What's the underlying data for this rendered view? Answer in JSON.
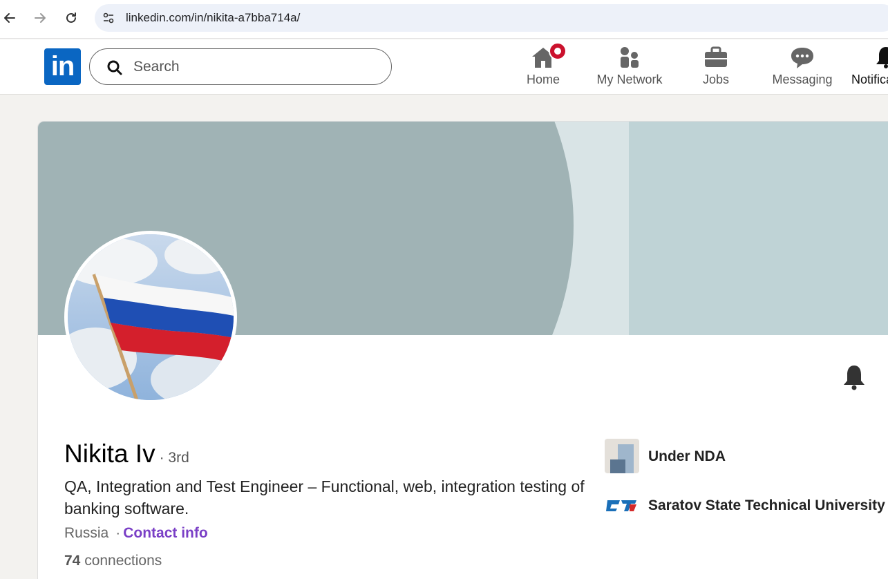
{
  "browser": {
    "url": "linkedin.com/in/nikita-a7bba714a/"
  },
  "linkedin_nav": {
    "logo_text": "in",
    "search_placeholder": "Search",
    "items": [
      {
        "label": "Home",
        "icon": "home-icon",
        "has_badge": true
      },
      {
        "label": "My Network",
        "icon": "people-icon"
      },
      {
        "label": "Jobs",
        "icon": "briefcase-icon"
      },
      {
        "label": "Messaging",
        "icon": "chat-icon"
      },
      {
        "label": "Notifications",
        "icon": "bell-icon"
      }
    ]
  },
  "profile": {
    "name": "Nikita Iv",
    "degree": "· 3rd",
    "headline": "QA, Integration and Test Engineer –  Functional, web, integration testing of banking software.",
    "location": "Russia",
    "contact_separator": "·",
    "contact_label": "Contact info",
    "connections_count": "74",
    "connections_label": "connections",
    "experience_org": "Under NDA",
    "education_org": "Saratov State Technical University",
    "avatar_icon": "russian-flag-photo"
  },
  "colors": {
    "brand": "#0a66c2",
    "badge": "#cb112d",
    "contact_link": "#7a3fc6",
    "banner_dark": "#a0b3b5",
    "banner_light": "#bfd3d6"
  }
}
